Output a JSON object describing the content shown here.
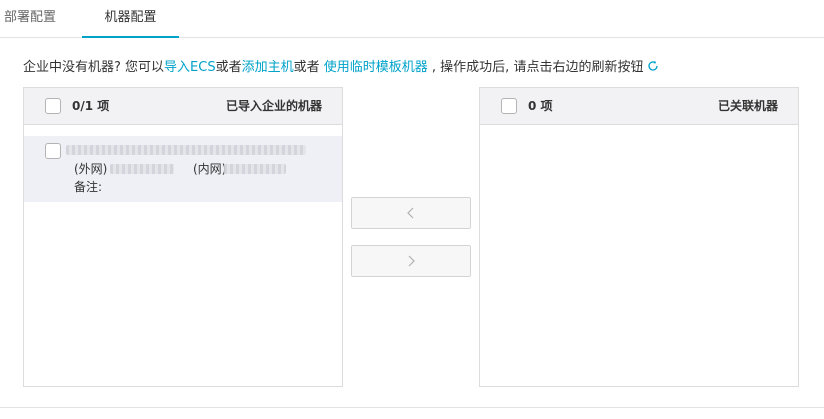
{
  "tabs": [
    {
      "label": "部署配置",
      "active": false
    },
    {
      "label": "机器配置",
      "active": true
    }
  ],
  "notice": {
    "prefix": "企业中没有机器? 您可以",
    "link_import": "导入ECS",
    "sep1": "或者",
    "link_add_host": "添加主机",
    "sep2": "或者 ",
    "link_temp": "使用临时模板机器",
    "suffix": " , 操作成功后, 请点击右边的刷新按钮",
    "refresh_icon": "refresh-icon"
  },
  "left_panel": {
    "count": "0/1 项",
    "title": "已导入企业的机器",
    "items": [
      {
        "public_label": "(外网)",
        "private_label": "(内网)",
        "remark_label": "备注:"
      }
    ]
  },
  "right_panel": {
    "count": "0 项",
    "title": "已关联机器"
  },
  "buttons": {
    "move_left_icon": "chevron-left-icon",
    "move_right_icon": "chevron-right-icon"
  },
  "colors": {
    "accent": "#00a2ca",
    "header_bg": "#f2f2f4",
    "item_bg": "#eef0f5",
    "border": "#dcdcdc"
  }
}
